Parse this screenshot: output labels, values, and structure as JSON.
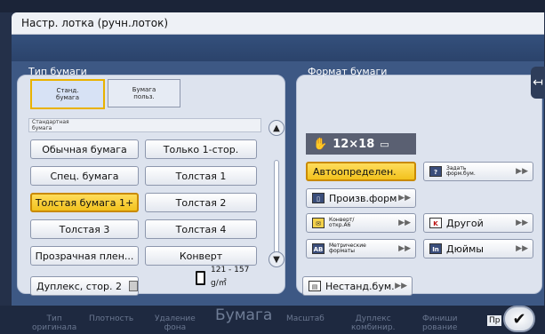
{
  "dialog": {
    "title": "Настр. лотка (ручн.лоток)"
  },
  "paper_type": {
    "title": "Тип бумаги",
    "tabs": [
      "Станд.\nбумага",
      "Бумага\nпольз."
    ],
    "section_label": "Стандартная\nбумага",
    "buttons": [
      "Обычная бумага",
      "Только 1-стор.",
      "Спец. бумага",
      "Толстая 1",
      "Толстая бумага 1+",
      "Толстая 2",
      "Толстая 3",
      "Толстая 4",
      "Прозрачная плен...",
      "Конверт"
    ],
    "selected": "Толстая бумага 1+",
    "duplex_label": "Дуплекс, стор. 2",
    "density_line1": "121 - 157",
    "density_line2": "g/㎡"
  },
  "paper_size": {
    "title": "Формат бумаги",
    "current_size": "12×18",
    "auto": "Автоопределен.",
    "set_size_small": "Задать\nформ.бум.",
    "custom_size": "Произв.форм",
    "envelope_small": "Конверт/\nоткр.A6",
    "other": "Другой",
    "metric_small": "Метрические\nформаты",
    "inches": "Дюймы",
    "nonstandard": "Нестанд.бум."
  },
  "bottom_nav": {
    "items": [
      "Тип\nоригинала",
      "Плотность",
      "Удаление\nфона",
      "Бумага",
      "Масштаб",
      "Дуплекс\nкомбинир.",
      "Финиши\nрование"
    ],
    "ok_label": "✔",
    "partial": "Пр"
  },
  "icons": {
    "scroll_up": "▲",
    "scroll_down": "▼",
    "side_tab": "↤",
    "arrow": "▶▶"
  }
}
